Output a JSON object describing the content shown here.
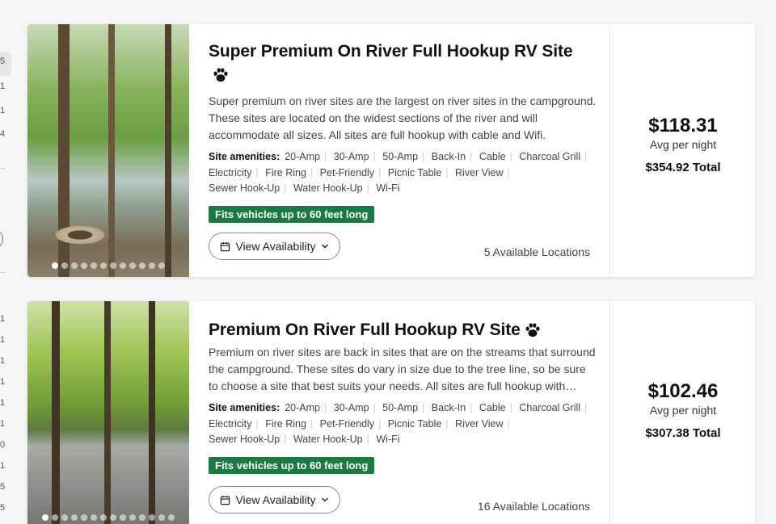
{
  "rail": {
    "nums": [
      "5",
      "1",
      "1",
      "4",
      "1",
      "1",
      "1",
      "1",
      "1",
      "1",
      "0",
      "1",
      "5",
      "5"
    ]
  },
  "cards": [
    {
      "title": "Super Premium On River Full Hookup RV Site",
      "pet_icon": "paw-icon",
      "description": "Super premium on river sites are the largest on river sites in the campground. These sites are located on the widest sections of the river and will accommodate all sizes. All sites are full hookup with cable and Wifi.",
      "amenities_label": "Site amenities:",
      "amenities": [
        "20-Amp",
        "30-Amp",
        "50-Amp",
        "Back-In",
        "Cable",
        "Charcoal Grill",
        "Electricity",
        "Fire Ring",
        "Pet-Friendly",
        "Picnic Table",
        "River View",
        "Sewer Hook-Up",
        "Water Hook-Up",
        "Wi-Fi"
      ],
      "fits": "Fits vehicles up to 60 feet long",
      "availability_button": "View Availability",
      "locations": "5 Available Locations",
      "price": "$118.31",
      "per_night": "Avg per night",
      "total": "$354.92 Total",
      "photo_dots": 12,
      "active_dot": 0
    },
    {
      "title": "Premium On River Full Hookup RV Site",
      "pet_icon": "paw-icon",
      "description": "Premium on river sites are back in sites that are on the streams that surround the campground. These sites do vary in size due to the tree line, so be sure to choose a site that best suits your needs. All sites are full hookup with…",
      "amenities_label": "Site amenities:",
      "amenities": [
        "20-Amp",
        "30-Amp",
        "50-Amp",
        "Back-In",
        "Cable",
        "Charcoal Grill",
        "Electricity",
        "Fire Ring",
        "Pet-Friendly",
        "Picnic Table",
        "River View",
        "Sewer Hook-Up",
        "Water Hook-Up",
        "Wi-Fi"
      ],
      "fits": "Fits vehicles up to 60 feet long",
      "availability_button": "View Availability",
      "locations": "16 Available Locations",
      "price": "$102.46",
      "per_night": "Avg per night",
      "total": "$307.38 Total",
      "photo_dots": 14,
      "active_dot": 0
    }
  ],
  "colors": {
    "fits_badge": "#197b42",
    "page_bg": "#f6f6f7"
  }
}
